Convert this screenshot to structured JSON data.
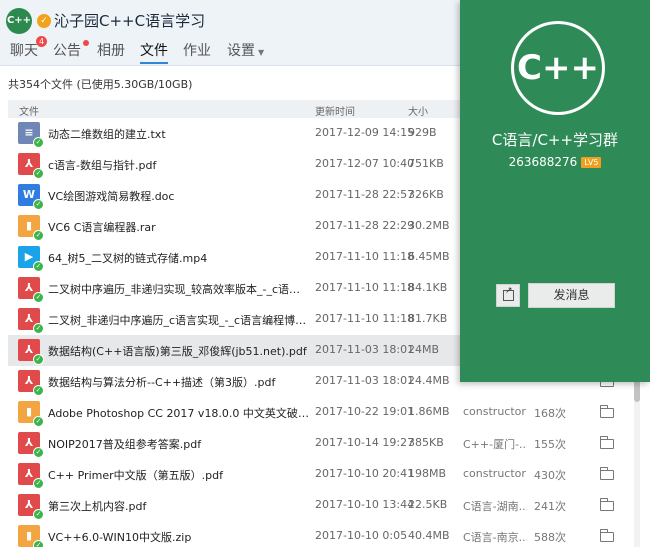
{
  "group": {
    "avatar_text": "C++",
    "title": "沁子园C++C语言学习"
  },
  "tabs": [
    {
      "label": "聊天",
      "badge": "4"
    },
    {
      "label": "公告"
    },
    {
      "label": "相册"
    },
    {
      "label": "文件"
    },
    {
      "label": "作业"
    },
    {
      "label": "设置"
    }
  ],
  "summary": "共354个文件 (已使用5.30GB/10GB)",
  "columns": {
    "file": "文件",
    "updated": "更新时间",
    "size": "大小"
  },
  "files": [
    {
      "name": "动态二维数组的建立.txt",
      "type": "txt",
      "date": "2017-12-09 14:15",
      "size": "929B",
      "uploader": "",
      "downloads": ""
    },
    {
      "name": "c语言-数组与指针.pdf",
      "type": "pdf",
      "date": "2017-12-07 10:40",
      "size": "751KB",
      "uploader": "",
      "downloads": ""
    },
    {
      "name": "VC绘图游戏简易教程.doc",
      "type": "doc",
      "date": "2017-11-28 22:57",
      "size": "326KB",
      "uploader": "",
      "downloads": ""
    },
    {
      "name": "VC6 C语言编程器.rar",
      "type": "rar",
      "date": "2017-11-28 22:29",
      "size": "30.2MB",
      "uploader": "",
      "downloads": ""
    },
    {
      "name": "64_树5_二叉树的链式存储.mp4",
      "type": "mp4",
      "date": "2017-11-10 11:18",
      "size": "6.45MB",
      "uploader": "",
      "downloads": ""
    },
    {
      "name": "二叉树中序遍历_非递归实现_较高效率版本_-_c语言编程博客...",
      "type": "pdf",
      "date": "2017-11-10 11:18",
      "size": "84.1KB",
      "uploader": "",
      "downloads": ""
    },
    {
      "name": "二叉树_非递归中序遍历_c语言实现_-_c语言编程博客.pdf",
      "type": "pdf",
      "date": "2017-11-10 11:18",
      "size": "81.7KB",
      "uploader": "",
      "downloads": ""
    },
    {
      "name": "数据结构(C++语言版)第三版_邓俊辉(jb51.net).pdf",
      "type": "pdf",
      "date": "2017-11-03 18:01",
      "size": "24MB",
      "uploader": "",
      "downloads": "",
      "selected": true
    },
    {
      "name": "数据结构与算法分析--C++描述（第3版）.pdf",
      "type": "pdf",
      "date": "2017-11-03 18:01",
      "size": "24.4MB",
      "uploader": "",
      "downloads": ""
    },
    {
      "name": "Adobe Photoshop CC 2017 v18.0.0 中文英文破解版(附注...",
      "type": "exe",
      "date": "2017-10-22 19:01",
      "size": "1.86MB",
      "uploader": "constructor",
      "downloads": "168次"
    },
    {
      "name": "NOIP2017普及组参考答案.pdf",
      "type": "pdf",
      "date": "2017-10-14 19:27",
      "size": "385KB",
      "uploader": "C++-厦门-...",
      "downloads": "155次"
    },
    {
      "name": "C++ Primer中文版（第五版）.pdf",
      "type": "pdf",
      "date": "2017-10-10 20:41",
      "size": "198MB",
      "uploader": "constructor",
      "downloads": "430次"
    },
    {
      "name": "第三次上机内容.pdf",
      "type": "pdf",
      "date": "2017-10-10 13:44",
      "size": "22.5KB",
      "uploader": "C语言-湖南...",
      "downloads": "241次"
    },
    {
      "name": "VC++6.0-WIN10中文版.zip",
      "type": "zip",
      "date": "2017-10-10 0:05",
      "size": "40.4MB",
      "uploader": "C语言-南京...",
      "downloads": "588次"
    }
  ],
  "type_glyphs": {
    "txt": "≡",
    "pdf": "⅄",
    "doc": "W",
    "rar": "▮",
    "zip": "▮",
    "mp4": "▶",
    "exe": "▮"
  },
  "card": {
    "logo_text": "C++",
    "name": "C语言/C++学习群",
    "id": "263688276",
    "level": "LV5",
    "send_label": "发消息",
    "color": "#2e8b57"
  }
}
